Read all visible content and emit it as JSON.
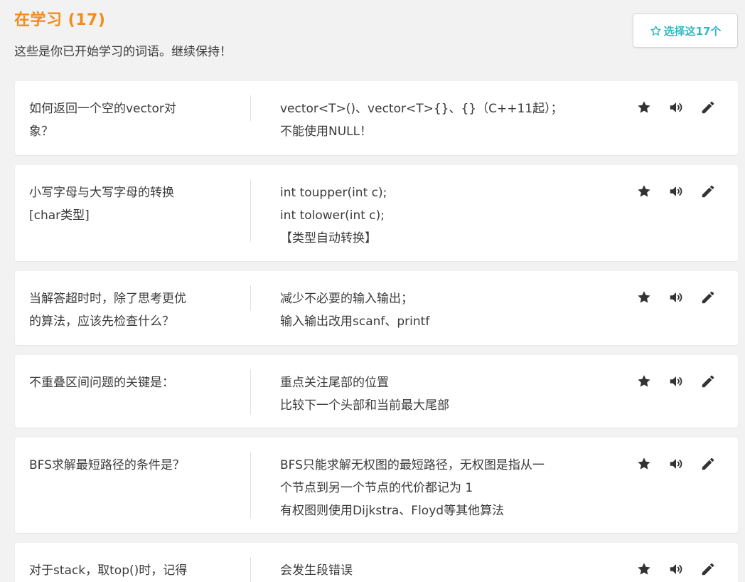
{
  "header": {
    "title": "在学习 (17)",
    "subtitle": "这些是你已开始学习的词语。继续保持！",
    "select_button_label": "选择这17个"
  },
  "colors": {
    "title": "#f28c1a",
    "accent": "#35b8c3",
    "text": "#3b3b3b",
    "background": "#f2f2f2",
    "icon": "#333333"
  },
  "icons": {
    "select_button": "star-outline-icon",
    "star": "star-icon",
    "speaker": "speaker-icon",
    "edit": "pencil-icon"
  },
  "cards": [
    {
      "word": "如何返回一个空的vector对\n象？",
      "definition": "vector<T>()、vector<T>{}、{}（C++11起）；\n不能使用NULL！"
    },
    {
      "word": "小写字母与大写字母的转换\n[char类型]",
      "definition": "int toupper(int c);\nint tolower(int c);\n【类型自动转换】"
    },
    {
      "word": "当解答超时时，除了思考更优\n的算法，应该先检查什么？",
      "definition": "减少不必要的输入输出；\n输入输出改用scanf、printf"
    },
    {
      "word": "不重叠区间问题的关键是：",
      "definition": "重点关注尾部的位置\n比较下一个头部和当前最大尾部"
    },
    {
      "word": "BFS求解最短路径的条件是？",
      "definition": "BFS只能求解无权图的最短路径，无权图是指从一\n个节点到另一个节点的代价都记为 1\n有权图则使用Dijkstra、Floyd等其他算法"
    },
    {
      "word": "对于stack，取top()时，记得",
      "definition": "会发生段错误"
    }
  ]
}
